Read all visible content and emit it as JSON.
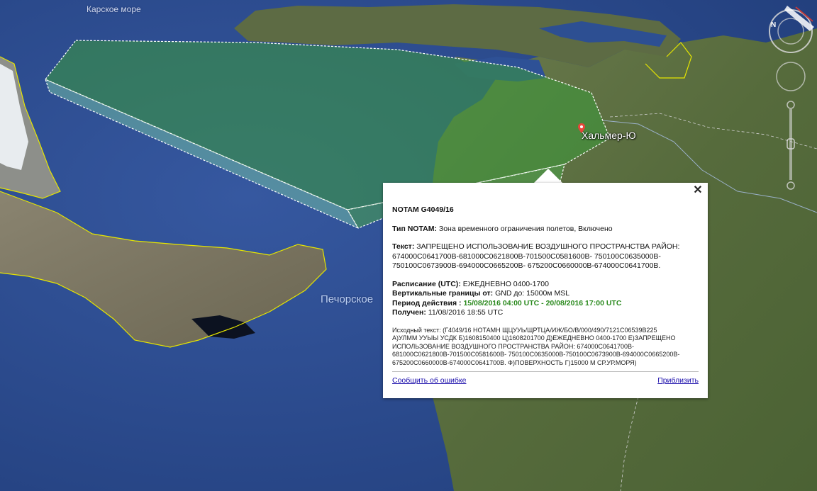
{
  "map": {
    "labels": {
      "kara_sea": "Карское море",
      "pechora_sea": "Печорское",
      "place": "Хальмер-Ю"
    },
    "icons": {
      "pin": "map-pin-icon",
      "compass": "compass-icon",
      "look": "look-joystick-icon",
      "zoom": "zoom-slider-icon"
    },
    "colors": {
      "sea": "#2c4a8c",
      "land": "#5f6b45",
      "zone_fill": "#3a9a3a",
      "zone_edge": "#ffffff",
      "coastline": "#e6e600"
    }
  },
  "popup": {
    "close": "✕",
    "title": "NOTAM G4049/16",
    "type_label": "Тип NOTAM:",
    "type_value": "Зона временного ограничения полетов, Включено",
    "text_label": "Текст:",
    "text_line1": "ЗАПРЕЩЕНО ИСПОЛЬЗОВАНИЕ ВОЗДУШНОГО ПРОСТРАНСТВА РАЙОН:",
    "text_line2": "674000С0641700В-681000С0621800В-701500С0581600В- 750100С0635000В-",
    "text_line3": "750100С0673900В-694000С0665200В- 675200С0660000В-674000С0641700В.",
    "schedule_label": "Расписание (UTC):",
    "schedule_value": "ЕЖЕДНЕВНО 0400-1700",
    "limits_label": "Вертикальные границы от:",
    "limits_value": "GND до: 15000м MSL",
    "period_label": "Период действия :",
    "period_value": "15/08/2016 04:00 UTC - 20/08/2016 17:00 UTC",
    "received_label": "Получен:",
    "received_value": "11/08/2016 18:55 UTC",
    "source_line1": "Исходный текст: (Г4049/16 НОТАМН ЩЦУУЬ/ЩРТЦА/ИЖ/БО/В/000/490/7121С06539В225",
    "source_line2": "А)УЛММ УУЫЫ УСДК Б)1608150400 Ц)1608201700 Д)ЕЖЕДНЕВНО 0400-1700 Е)ЗАПРЕЩЕНО",
    "source_line3": "ИСПОЛЬЗОВАНИЕ ВОЗДУШНОГО ПРОСТРАНСТВА РАЙОН: 674000С0641700В-",
    "source_line4": "681000С0621800В-701500С0581600В- 750100С0635000В-750100С0673900В-694000С0665200В-",
    "source_line5": "675200С0660000В-674000С0641700В. Ф)ПОВЕРХНОСТЬ Г)15000 М СР.УР.МОРЯ)",
    "report_link": "Сообщить об ошибке",
    "zoom_link": "Приблизить"
  }
}
